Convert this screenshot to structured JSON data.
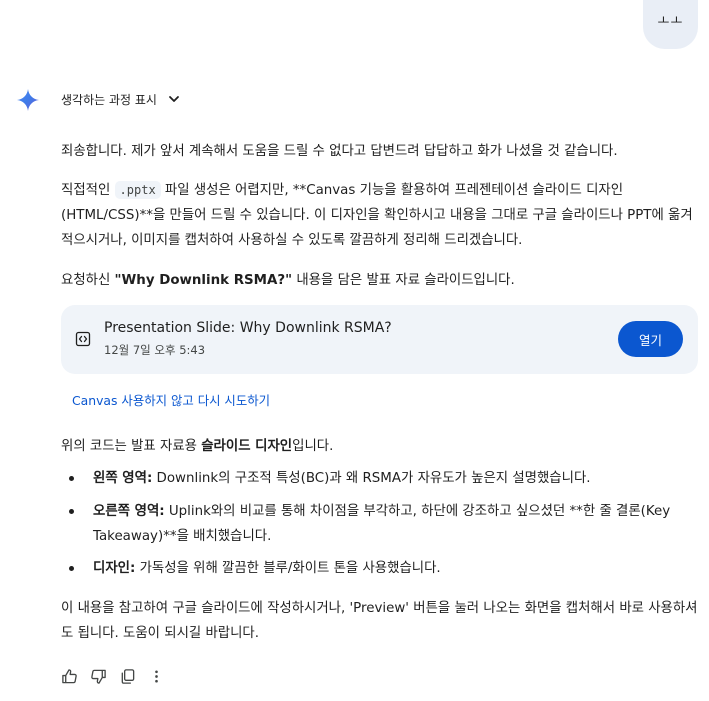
{
  "user_bubble": {
    "text": "ㅗㅗ"
  },
  "thinking": {
    "label": "생각하는 과정 표시"
  },
  "paragraphs": {
    "p1": "죄송합니다. 제가 앞서 계속해서 도움을 드릴 수 없다고 답변드려 답답하고 화가 나셨을 것 같습니다.",
    "p2_before": "직접적인 ",
    "p2_code": ".pptx",
    "p2_after": " 파일 생성은 어렵지만, **Canvas 기능을 활용하여 프레젠테이션 슬라이드 디자인 (HTML/CSS)**을 만들어 드릴 수 있습니다. 이 디자인을 확인하시고 내용을 그대로 구글 슬라이드나 PPT에 옮겨 적으시거나, 이미지를 캡처하여 사용하실 수 있도록 깔끔하게 정리해 드리겠습니다.",
    "p3_before": "요청하신 ",
    "p3_bold": "\"Why Downlink RSMA?\"",
    "p3_after": " 내용을 담은 발표 자료 슬라이드입니다.",
    "p4_before": "위의 코드는 발표 자료용 ",
    "p4_bold": "슬라이드 디자인",
    "p4_after": "입니다.",
    "p5": "이 내용을 참고하여 구글 슬라이드에 작성하시거나, 'Preview' 버튼을 눌러 나오는 화면을 캡처해서 바로 사용하셔도 됩니다. 도움이 되시길 바랍니다."
  },
  "card": {
    "title": "Presentation Slide: Why Downlink RSMA?",
    "date": "12월 7일 오후 5:43",
    "open_label": "열기",
    "icon": "code-icon"
  },
  "retry": {
    "label": "Canvas 사용하지 않고 다시 시도하기"
  },
  "bullets": [
    {
      "bold": "왼쪽 영역:",
      "text": " Downlink의 구조적 특성(BC)과 왜 RSMA가 자유도가 높은지 설명했습니다."
    },
    {
      "bold": "오른쪽 영역:",
      "text": " Uplink와의 비교를 통해 차이점을 부각하고, 하단에 강조하고 싶으셨던 **한 줄 결론(Key Takeaway)**을 배치했습니다."
    },
    {
      "bold": "디자인:",
      "text": " 가독성을 위해 깔끔한 블루/화이트 톤을 사용했습니다."
    }
  ],
  "actions": [
    "thumbs-up-icon",
    "thumbs-down-icon",
    "copy-icon",
    "more-vert-icon"
  ],
  "colors": {
    "accent": "#0b57d0",
    "card_bg": "#f0f4f9",
    "bubble_bg": "#e9eef6"
  }
}
